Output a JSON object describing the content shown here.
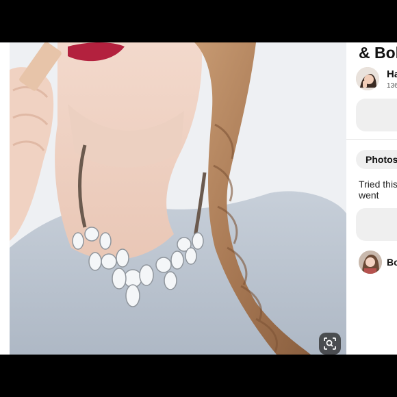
{
  "pin": {
    "title": "& Bol",
    "creator_name": "Ha",
    "creator_followers": "136",
    "photos_tab_label": "Photos",
    "tried_text": "Tried this went",
    "commenter_name": "Bo"
  },
  "colors": {
    "panel_bg": "#ffffff",
    "button_bg": "#efefef",
    "frame": "#000000"
  },
  "icons": {
    "visual_search": "visual-search-icon"
  }
}
